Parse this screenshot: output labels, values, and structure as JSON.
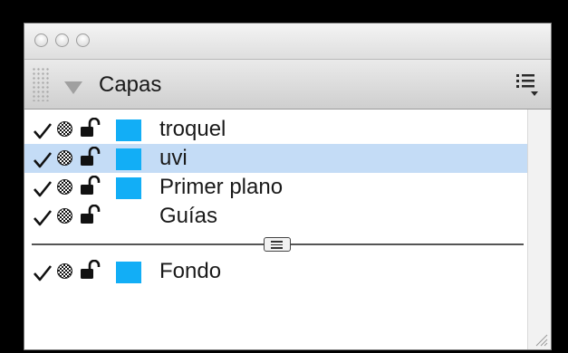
{
  "panel": {
    "title": "Capas",
    "icons": {
      "collapse": "disclosure-triangle-icon",
      "menu": "panel-menu-icon"
    }
  },
  "window": {
    "buttons": [
      "close",
      "minimize",
      "zoom"
    ]
  },
  "layers": [
    {
      "name": "troquel",
      "visible": true,
      "printable": true,
      "locked": false,
      "color": "#12aef6",
      "selected": false,
      "active_pen": false
    },
    {
      "name": "uvi",
      "visible": true,
      "printable": true,
      "locked": false,
      "color": "#12aef6",
      "selected": true,
      "active_pen": true
    },
    {
      "name": "Primer plano",
      "visible": true,
      "printable": true,
      "locked": false,
      "color": "#12aef6",
      "selected": false,
      "active_pen": false
    },
    {
      "name": "Guías",
      "visible": true,
      "printable": true,
      "locked": false,
      "color": null,
      "selected": false,
      "active_pen": false
    },
    {
      "name": "Fondo",
      "visible": true,
      "printable": true,
      "locked": false,
      "color": "#12aef6",
      "selected": false,
      "active_pen": false
    }
  ],
  "colors": {
    "selection": "#c4dcf6",
    "layer_color": "#12aef6",
    "background": "#000000"
  }
}
